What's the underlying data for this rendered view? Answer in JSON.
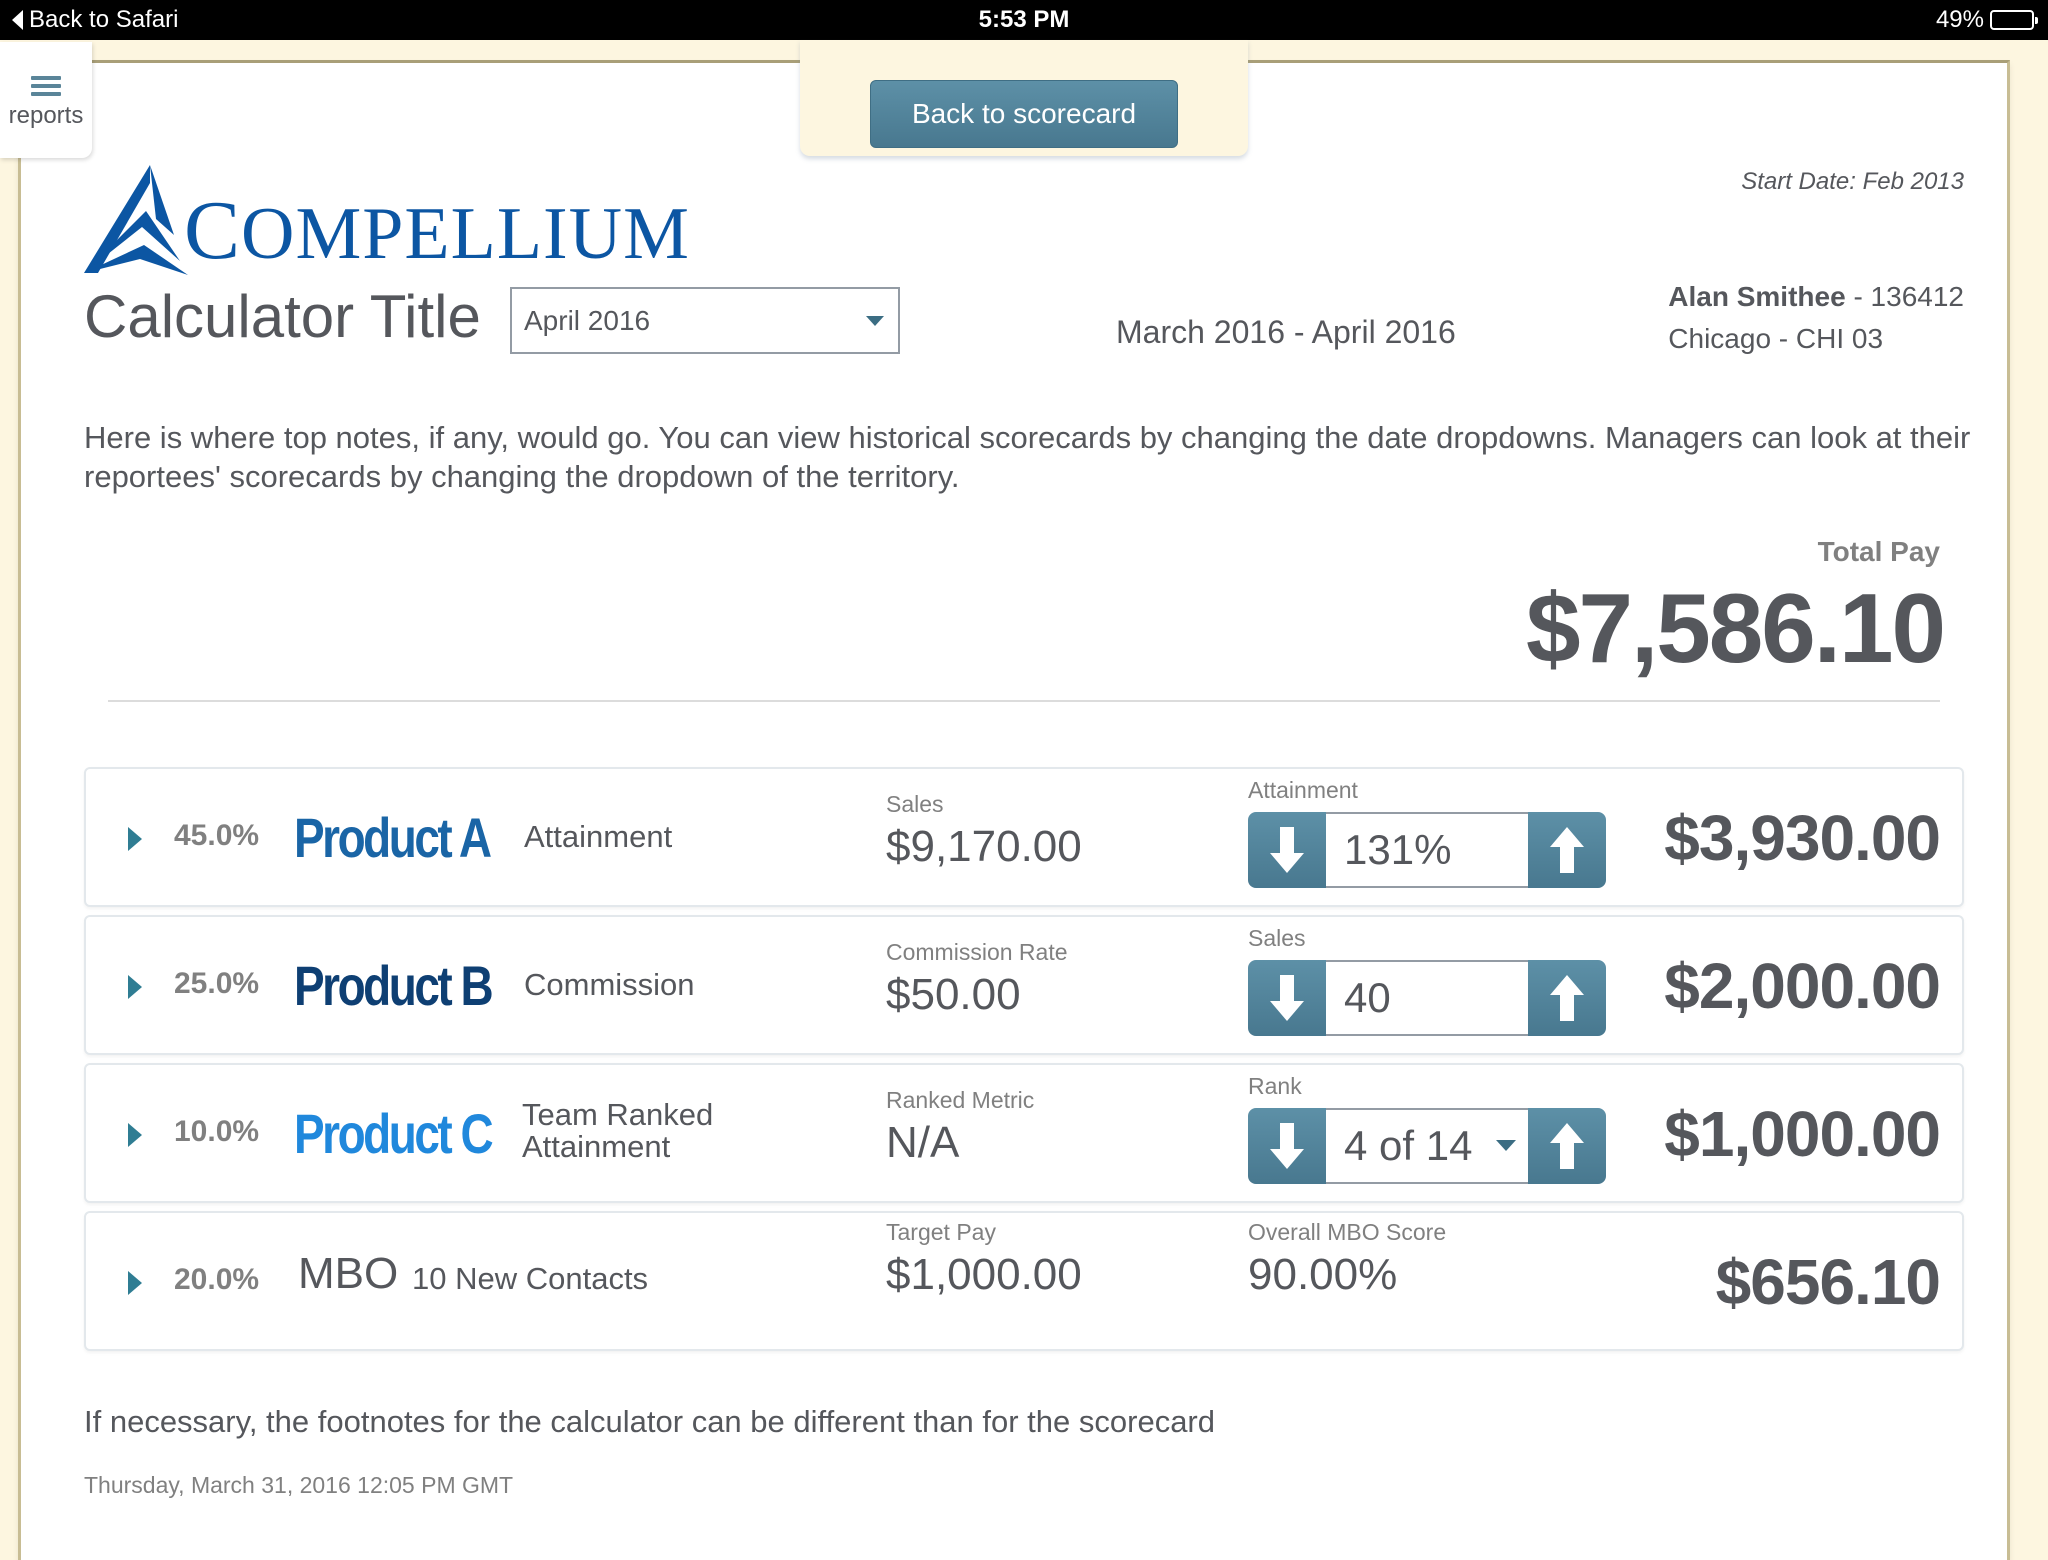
{
  "statusbar": {
    "back_label": "Back to Safari",
    "time": "5:53 PM",
    "battery_text": "49%",
    "battery_level": 0.49
  },
  "nav": {
    "reports_label": "reports",
    "back_button_label": "Back to scorecard"
  },
  "header": {
    "logo_text": "Compellium",
    "start_date": "Start Date: Feb 2013",
    "title": "Calculator Title",
    "period_select": "April 2016",
    "date_range": "March 2016 - April 2016",
    "user_name": "Alan Smithee",
    "user_id": " - 136412",
    "location": "Chicago - CHI 03"
  },
  "notes": "Here is where top notes, if any, would go. You can view historical scorecards by changing the date dropdowns. Managers can look at their reportees' scorecards by changing the dropdown of the territory.",
  "total": {
    "label": "Total Pay",
    "value": "$7,586.10"
  },
  "rows": [
    {
      "weight": "45.0%",
      "name": "Product A",
      "name_color": "#1a65a6",
      "type": "Attainment",
      "col1_label": "Sales",
      "col1_value": "$9,170.00",
      "col2_label": "Attainment",
      "col2_value": "131%",
      "amount": "$3,930.00"
    },
    {
      "weight": "25.0%",
      "name": "Product B",
      "name_color": "#0e3f73",
      "type": "Commission",
      "col1_label": "Commission Rate",
      "col1_value": "$50.00",
      "col2_label": "Sales",
      "col2_value": "40",
      "amount": "$2,000.00"
    },
    {
      "weight": "10.0%",
      "name": "Product C",
      "name_color": "#2088dc",
      "type_line1": "Team Ranked",
      "type_line2": "Attainment",
      "col1_label": "Ranked Metric",
      "col1_value": "N/A",
      "col2_label": "Rank",
      "col2_value": "4 of 14",
      "amount": "$1,000.00"
    },
    {
      "weight": "20.0%",
      "name": "MBO",
      "type": "10 New Contacts",
      "col1_label": "Target Pay",
      "col1_value": "$1,000.00",
      "col2_label": "Overall MBO Score",
      "col2_value": "90.00%",
      "amount": "$656.10"
    }
  ],
  "footnote": "If necessary, the footnotes for the calculator can be different than for the scorecard",
  "timestamp": "Thursday, March 31, 2016 12:05 PM GMT"
}
